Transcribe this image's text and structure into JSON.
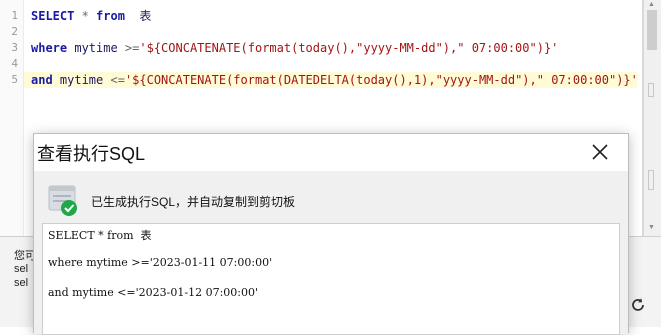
{
  "editor": {
    "line_numbers": [
      "1",
      "2",
      "3",
      "4",
      "5"
    ],
    "line1": {
      "kw1": "SELECT",
      "star": " * ",
      "kw2": "from",
      "table": "  表"
    },
    "line3": {
      "kw1": "where",
      "col": " mytime ",
      "op": ">=",
      "str": "'${CONCATENATE(format(today(),\"yyyy-MM-dd\"),\" 07:00:00\")}'"
    },
    "line5": {
      "kw1": "and",
      "col": " mytime ",
      "op": "<=",
      "str": "'${CONCATENATE(format(DATEDELTA(today(),1),\"yyyy-MM-dd\"),\" 07:00:00\")}'"
    }
  },
  "bottom_panel": {
    "lines": [
      "您可",
      "sel",
      "sel"
    ]
  },
  "dialog": {
    "title": "查看执行SQL",
    "message": "已生成执行SQL，并自动复制到剪切板",
    "result_lines": [
      "SELECT * from  表",
      "where mytime >='2023-01-11 07:00:00'",
      "and mytime <='2023-01-12 07:00:00'"
    ]
  },
  "icons": {
    "close": "close-icon",
    "sql_success": "sql-success-icon",
    "refresh": "refresh-icon"
  },
  "colors": {
    "keyword": "#1a1aa6",
    "string": "#a31515",
    "highlight_line": "#fffbd6",
    "success_green": "#1fa84a"
  }
}
